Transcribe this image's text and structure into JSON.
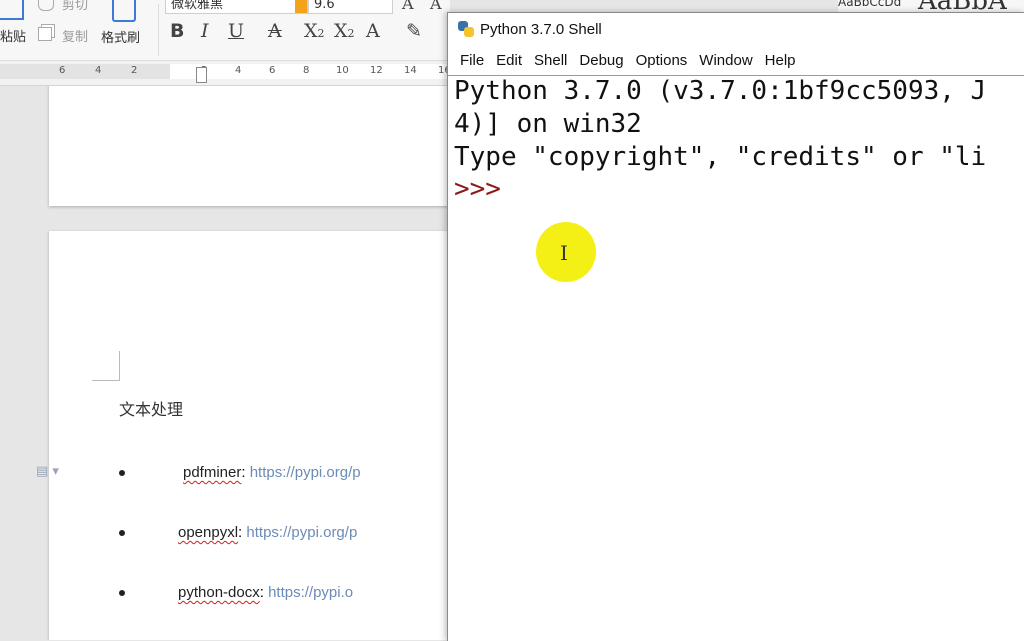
{
  "ribbon": {
    "paste_label": "粘贴",
    "cut_label": "剪切",
    "copy_label": "复制",
    "format_painter_label": "格式刷",
    "font_name": "微软雅黑",
    "font_size": "9.6",
    "style_preview_1": "AaBbCcDd",
    "style_preview_2": "AaBbA"
  },
  "ruler": {
    "ticks": [
      "6",
      "4",
      "2",
      "2",
      "4",
      "6",
      "8",
      "10",
      "12",
      "14",
      "16"
    ]
  },
  "document": {
    "heading": "文本处理",
    "bullets": [
      {
        "package": "pdfminer",
        "sep": ":",
        "url": "https://pypi.org/p"
      },
      {
        "package": "openpyxl",
        "sep": ":",
        "url": "https://pypi.org/p"
      },
      {
        "package": "python-docx",
        "sep": ":",
        "url": "https://pypi.o"
      }
    ]
  },
  "shell": {
    "title": "Python 3.7.0 Shell",
    "menu": [
      "File",
      "Edit",
      "Shell",
      "Debug",
      "Options",
      "Window",
      "Help"
    ],
    "lines": [
      "Python 3.7.0 (v3.7.0:1bf9cc5093, J",
      "4)] on win32",
      "Type \"copyright\", \"credits\" or \"li"
    ],
    "prompt": ">>>"
  },
  "colors": {
    "prompt": "#8b1a1a",
    "cursor_highlight": "#f3ee00",
    "link": "#6b8bb8"
  }
}
